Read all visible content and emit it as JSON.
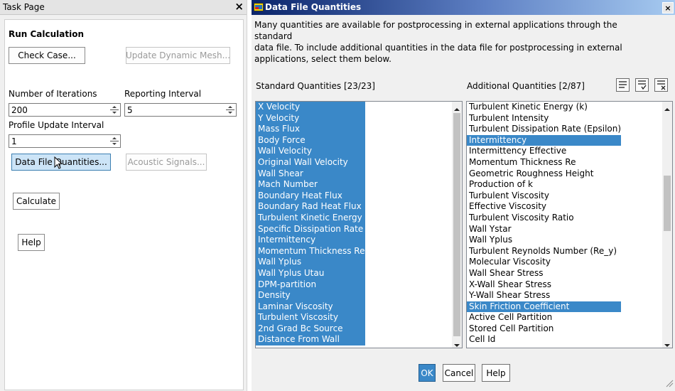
{
  "task_page": {
    "title": "Task Page",
    "close_glyph": "×",
    "section_title": "Run Calculation",
    "check_case_label": "Check Case...",
    "update_dynamic_mesh_label": "Update Dynamic Mesh...",
    "num_iterations_label": "Number of Iterations",
    "num_iterations_value": "200",
    "reporting_interval_label": "Reporting Interval",
    "reporting_interval_value": "5",
    "profile_update_label": "Profile Update Interval",
    "profile_update_value": "1",
    "data_file_quantities_label": "Data File Quantities...",
    "acoustic_signals_label": "Acoustic Signals...",
    "calculate_label": "Calculate",
    "help_label": "Help"
  },
  "dialog": {
    "title": "Data File Quantities",
    "close_glyph": "×",
    "description_line1": "Many quantities are available for postprocessing in external applications through the standard",
    "description_line2": "data file. To include additional quantities in the data file for postprocessing in external",
    "description_line3": "applications, select them below.",
    "standard_label": "Standard Quantities [23/23]",
    "additional_label": "Additional Quantities [2/87]",
    "standard_items": [
      {
        "label": "X Velocity",
        "selected": true
      },
      {
        "label": "Y Velocity",
        "selected": true
      },
      {
        "label": "Mass Flux",
        "selected": true
      },
      {
        "label": "Body Force",
        "selected": true
      },
      {
        "label": "Wall Velocity",
        "selected": true
      },
      {
        "label": "Original Wall Velocity",
        "selected": true
      },
      {
        "label": "Wall Shear",
        "selected": true
      },
      {
        "label": "Mach Number",
        "selected": true
      },
      {
        "label": "Boundary Heat Flux",
        "selected": true
      },
      {
        "label": "Boundary Rad Heat Flux",
        "selected": true
      },
      {
        "label": "Turbulent Kinetic Energy",
        "selected": true
      },
      {
        "label": "Specific Dissipation Rate",
        "selected": true
      },
      {
        "label": "Intermittency",
        "selected": true
      },
      {
        "label": "Momentum Thickness Re",
        "selected": true
      },
      {
        "label": "Wall Yplus",
        "selected": true
      },
      {
        "label": "Wall Yplus Utau",
        "selected": true
      },
      {
        "label": "DPM-partition",
        "selected": true
      },
      {
        "label": "Density",
        "selected": true
      },
      {
        "label": "Laminar Viscosity",
        "selected": true
      },
      {
        "label": "Turbulent Viscosity",
        "selected": true
      },
      {
        "label": "2nd Grad Bc Source",
        "selected": true
      },
      {
        "label": "Distance From Wall",
        "selected": true
      }
    ],
    "additional_items": [
      {
        "label": "Turbulent Kinetic Energy (k)",
        "selected": false
      },
      {
        "label": "Turbulent Intensity",
        "selected": false
      },
      {
        "label": "Turbulent Dissipation Rate (Epsilon)",
        "selected": false
      },
      {
        "label": "Intermittency",
        "selected": true
      },
      {
        "label": "Intermittency Effective",
        "selected": false
      },
      {
        "label": "Momentum Thickness Re",
        "selected": false
      },
      {
        "label": "Geometric Roughness Height",
        "selected": false
      },
      {
        "label": "Production of k",
        "selected": false
      },
      {
        "label": "Turbulent Viscosity",
        "selected": false
      },
      {
        "label": "Effective Viscosity",
        "selected": false
      },
      {
        "label": "Turbulent Viscosity Ratio",
        "selected": false
      },
      {
        "label": "Wall Ystar",
        "selected": false
      },
      {
        "label": "Wall Yplus",
        "selected": false
      },
      {
        "label": "Turbulent Reynolds Number (Re_y)",
        "selected": false
      },
      {
        "label": "Molecular Viscosity",
        "selected": false
      },
      {
        "label": "Wall Shear Stress",
        "selected": false
      },
      {
        "label": "X-Wall Shear Stress",
        "selected": false
      },
      {
        "label": "Y-Wall Shear Stress",
        "selected": false
      },
      {
        "label": "Skin Friction Coefficient",
        "selected": true
      },
      {
        "label": "Active Cell Partition",
        "selected": false
      },
      {
        "label": "Stored Cell Partition",
        "selected": false
      },
      {
        "label": "Cell Id",
        "selected": false
      }
    ],
    "ok_label": "OK",
    "cancel_label": "Cancel",
    "help_label": "Help"
  },
  "colors": {
    "selection": "#3a88c8",
    "titlebar_start": "#0a246a",
    "titlebar_end": "#a6caf0"
  },
  "icons": [
    "close-icon",
    "spinner-icon",
    "cursor-icon",
    "app-icon",
    "select-all-icon",
    "select-visible-icon",
    "deselect-all-icon",
    "scroll-up-icon",
    "scroll-down-icon",
    "resize-grip-icon"
  ]
}
